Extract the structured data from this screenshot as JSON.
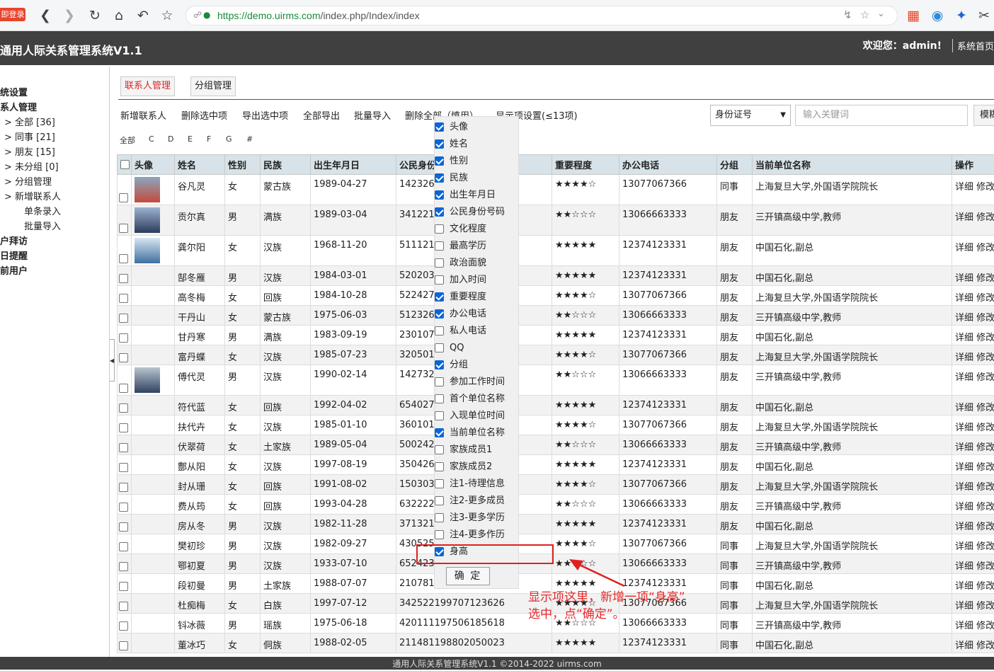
{
  "browser": {
    "login_badge": "即登录",
    "url_host": "https://demo.uirms.com",
    "url_path": "/index.php/Index/index"
  },
  "header": {
    "title": "通用人际关系管理系统V1.1",
    "welcome": "欢迎您：admin!",
    "home": "系统首页"
  },
  "sidebar": {
    "items": [
      {
        "label": "统设置"
      },
      {
        "label": "系人管理"
      },
      {
        "label": "> 全部 [36]"
      },
      {
        "label": "> 同事 [21]"
      },
      {
        "label": "> 朋友 [15]"
      },
      {
        "label": "> 未分组 [0]"
      },
      {
        "label": "> 分组管理"
      },
      {
        "label": "> 新增联系人"
      },
      {
        "label": "单条录入"
      },
      {
        "label": "批量导入"
      },
      {
        "label": "户拜访"
      },
      {
        "label": "日提醒"
      },
      {
        "label": "前用户"
      }
    ]
  },
  "tabs": [
    {
      "label": "联系人管理"
    },
    {
      "label": "分组管理"
    }
  ],
  "actions": {
    "items": [
      {
        "label": "新增联系人"
      },
      {
        "label": "删除选中项"
      },
      {
        "label": "导出选中项"
      },
      {
        "label": "全部导出"
      },
      {
        "label": "批量导入"
      },
      {
        "label": "删除全部（慎用）"
      },
      {
        "label": "显示项设置(≤13项)"
      }
    ]
  },
  "search": {
    "field": "身份证号",
    "placeholder": "输入关键词",
    "button": "模糊"
  },
  "letters": [
    "全部",
    "C",
    "D",
    "E",
    "F",
    "G",
    "#"
  ],
  "table": {
    "headers": [
      "头像",
      "姓名",
      "性别",
      "民族",
      "出生年月日",
      "公民身份证号",
      "重要程度",
      "办公电话",
      "分组",
      "当前单位名称",
      "操作"
    ],
    "ops": "详细 修改",
    "rows": [
      {
        "name": "谷凡灵",
        "gender": "女",
        "ethnic": "蒙古族",
        "birth": "1989-04-27",
        "id": "142326",
        "stars": "★★★★☆",
        "phone": "13077067366",
        "group": "同事",
        "company": "上海复旦大学,外国语学院院长"
      },
      {
        "name": "贡尔真",
        "gender": "男",
        "ethnic": "满族",
        "birth": "1989-03-04",
        "id": "341221",
        "stars": "★★☆☆☆",
        "phone": "13066663333",
        "group": "朋友",
        "company": "三开镇高级中学,教师"
      },
      {
        "name": "龚尔阳",
        "gender": "女",
        "ethnic": "汉族",
        "birth": "1968-11-20",
        "id": "511121",
        "stars": "★★★★★",
        "phone": "12374123331",
        "group": "朋友",
        "company": "中国石化,副总"
      },
      {
        "name": "郜冬雁",
        "gender": "男",
        "ethnic": "汉族",
        "birth": "1984-03-01",
        "id": "520203",
        "stars": "★★★★★",
        "phone": "12374123331",
        "group": "朋友",
        "company": "中国石化,副总"
      },
      {
        "name": "高冬梅",
        "gender": "女",
        "ethnic": "回族",
        "birth": "1984-10-28",
        "id": "522427",
        "stars": "★★★★☆",
        "phone": "13077067366",
        "group": "朋友",
        "company": "上海复旦大学,外国语学院院长"
      },
      {
        "name": "干丹山",
        "gender": "女",
        "ethnic": "蒙古族",
        "birth": "1975-06-03",
        "id": "512326",
        "stars": "★★☆☆☆",
        "phone": "13066663333",
        "group": "朋友",
        "company": "三开镇高级中学,教师"
      },
      {
        "name": "甘丹寒",
        "gender": "男",
        "ethnic": "满族",
        "birth": "1983-09-19",
        "id": "230107",
        "stars": "★★★★★",
        "phone": "12374123331",
        "group": "朋友",
        "company": "中国石化,副总"
      },
      {
        "name": "富丹蝶",
        "gender": "女",
        "ethnic": "汉族",
        "birth": "1985-07-23",
        "id": "320501",
        "stars": "★★★★☆",
        "phone": "13077067366",
        "group": "朋友",
        "company": "上海复旦大学,外国语学院院长"
      },
      {
        "name": "傅代灵",
        "gender": "男",
        "ethnic": "汉族",
        "birth": "1990-02-14",
        "id": "142732",
        "stars": "★★☆☆☆",
        "phone": "13066663333",
        "group": "朋友",
        "company": "三开镇高级中学,教师"
      },
      {
        "name": "符代蓝",
        "gender": "女",
        "ethnic": "回族",
        "birth": "1992-04-02",
        "id": "654027",
        "stars": "★★★★★",
        "phone": "12374123331",
        "group": "朋友",
        "company": "中国石化,副总"
      },
      {
        "name": "扶代卉",
        "gender": "女",
        "ethnic": "汉族",
        "birth": "1985-01-10",
        "id": "360101",
        "stars": "★★★★☆",
        "phone": "13077067366",
        "group": "朋友",
        "company": "上海复旦大学,外国语学院院长"
      },
      {
        "name": "伏翠荷",
        "gender": "女",
        "ethnic": "土家族",
        "birth": "1989-05-04",
        "id": "500242",
        "stars": "★★☆☆☆",
        "phone": "13066663333",
        "group": "朋友",
        "company": "三开镇高级中学,教师"
      },
      {
        "name": "鄷从阳",
        "gender": "女",
        "ethnic": "汉族",
        "birth": "1997-08-19",
        "id": "350426",
        "stars": "★★★★★",
        "phone": "12374123331",
        "group": "朋友",
        "company": "中国石化,副总"
      },
      {
        "name": "封从珊",
        "gender": "女",
        "ethnic": "回族",
        "birth": "1991-08-02",
        "id": "150303",
        "stars": "★★★★☆",
        "phone": "13077067366",
        "group": "朋友",
        "company": "上海复旦大学,外国语学院院长"
      },
      {
        "name": "费从筠",
        "gender": "女",
        "ethnic": "回族",
        "birth": "1993-04-28",
        "id": "632222",
        "stars": "★★☆☆☆",
        "phone": "13066663333",
        "group": "朋友",
        "company": "三开镇高级中学,教师"
      },
      {
        "name": "房从冬",
        "gender": "男",
        "ethnic": "汉族",
        "birth": "1982-11-28",
        "id": "371321",
        "stars": "★★★★★",
        "phone": "12374123331",
        "group": "朋友",
        "company": "中国石化,副总"
      },
      {
        "name": "樊初珍",
        "gender": "男",
        "ethnic": "汉族",
        "birth": "1982-09-27",
        "id": "430525",
        "stars": "★★★★☆",
        "phone": "13077067366",
        "group": "同事",
        "company": "上海复旦大学,外国语学院院长"
      },
      {
        "name": "鄂初夏",
        "gender": "男",
        "ethnic": "汉族",
        "birth": "1933-07-10",
        "id": "652423",
        "stars": "★★☆☆☆",
        "phone": "13066663333",
        "group": "同事",
        "company": "三开镇高级中学,教师"
      },
      {
        "name": "段初曼",
        "gender": "男",
        "ethnic": "土家族",
        "birth": "1988-07-07",
        "id": "210781",
        "stars": "★★★★★",
        "phone": "12374123331",
        "group": "同事",
        "company": "中国石化,副总"
      },
      {
        "name": "杜痴梅",
        "gender": "女",
        "ethnic": "白族",
        "birth": "1997-07-12",
        "id": "342522199707123626",
        "stars": "★★★★☆",
        "phone": "13077067366",
        "group": "同事",
        "company": "上海复旦大学,外国语学院院长"
      },
      {
        "name": "钭冰薇",
        "gender": "男",
        "ethnic": "瑶族",
        "birth": "1975-06-18",
        "id": "420111197506185618",
        "stars": "★★☆☆☆",
        "phone": "13066663333",
        "group": "同事",
        "company": "三开镇高级中学,教师"
      },
      {
        "name": "董冰巧",
        "gender": "女",
        "ethnic": "侗族",
        "birth": "1988-02-05",
        "id": "211481198802050023",
        "stars": "★★★★★",
        "phone": "12374123331",
        "group": "同事",
        "company": "中国石化,副总"
      }
    ]
  },
  "dropdown": {
    "items": [
      {
        "label": "头像",
        "checked": true
      },
      {
        "label": "姓名",
        "checked": true
      },
      {
        "label": "性别",
        "checked": true
      },
      {
        "label": "民族",
        "checked": true
      },
      {
        "label": "出生年月日",
        "checked": true
      },
      {
        "label": "公民身份号码",
        "checked": true
      },
      {
        "label": "文化程度",
        "checked": false
      },
      {
        "label": "最高学历",
        "checked": false
      },
      {
        "label": "政治面貌",
        "checked": false
      },
      {
        "label": "加入时间",
        "checked": false
      },
      {
        "label": "重要程度",
        "checked": true
      },
      {
        "label": "办公电话",
        "checked": true
      },
      {
        "label": "私人电话",
        "checked": false
      },
      {
        "label": "QQ",
        "checked": false
      },
      {
        "label": "分组",
        "checked": true
      },
      {
        "label": "参加工作时间",
        "checked": false
      },
      {
        "label": "首个单位名称",
        "checked": false
      },
      {
        "label": "入现单位时间",
        "checked": false
      },
      {
        "label": "当前单位名称",
        "checked": true
      },
      {
        "label": "家族成员1",
        "checked": false
      },
      {
        "label": "家族成员2",
        "checked": false
      },
      {
        "label": "注1-待理信息",
        "checked": false
      },
      {
        "label": "注2-更多成员",
        "checked": false
      },
      {
        "label": "注3-更多学历",
        "checked": false
      },
      {
        "label": "注4-更多作历",
        "checked": false
      },
      {
        "label": "身高",
        "checked": true
      }
    ],
    "ok": "确 定"
  },
  "annotation": {
    "line1": "显示项这里，新增一项“身高”",
    "line2": "选中，点“确定”。"
  },
  "footer": "通用人际关系管理系统V1.1 ©2014-2022 uirms.com",
  "colors": {
    "header_bg": "#404040",
    "table_header_bg": "#d7e3e8",
    "annotation": "#e32a2a",
    "url_green": "#1a8a3a"
  }
}
